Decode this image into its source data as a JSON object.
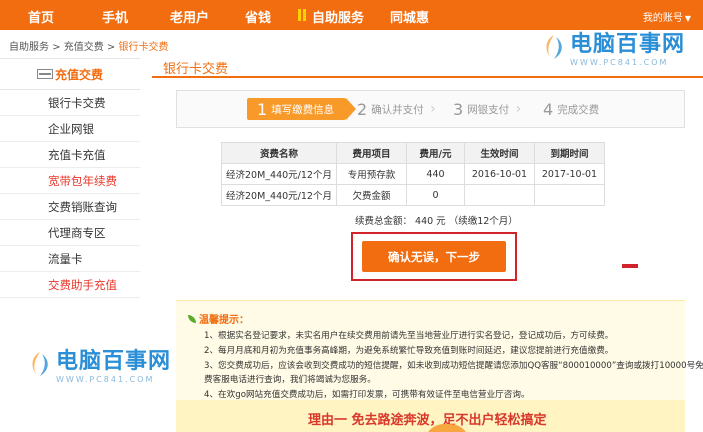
{
  "nav": {
    "items": [
      "首页",
      "手机",
      "老用户",
      "省钱",
      "自助服务",
      "同城惠"
    ],
    "account": "我的账号"
  },
  "breadcrumb": {
    "parts": [
      "自助服务",
      "充值交费"
    ],
    "current": "银行卡交费",
    "sep": " > "
  },
  "watermark": {
    "name": "电脑百事网",
    "url": "WWW.PC841.COM"
  },
  "sidebar": {
    "header": "充值交费",
    "items": [
      {
        "label": "银行卡交费",
        "hot": false
      },
      {
        "label": "企业网银",
        "hot": false
      },
      {
        "label": "充值卡充值",
        "hot": false
      },
      {
        "label": "宽带包年续费",
        "hot": true
      },
      {
        "label": "交费销账查询",
        "hot": false
      },
      {
        "label": "代理商专区",
        "hot": false
      },
      {
        "label": "流量卡",
        "hot": false
      },
      {
        "label": "交费助手充值",
        "hot": true
      }
    ]
  },
  "main": {
    "title": "银行卡交费",
    "steps": [
      {
        "num": "1",
        "label": "填写缴费信息"
      },
      {
        "num": "2",
        "label": "确认并支付"
      },
      {
        "num": "3",
        "label": "网银支付"
      },
      {
        "num": "4",
        "label": "完成交费"
      }
    ],
    "table": {
      "headers": [
        "资费名称",
        "费用项目",
        "费用/元",
        "生效时间",
        "到期时间"
      ],
      "rows": [
        [
          "经济20M_440元/12个月",
          "专用预存款",
          "440",
          "2016-10-01",
          "2017-10-01"
        ],
        [
          "经济20M_440元/12个月",
          "欠费金额",
          "0",
          "",
          ""
        ]
      ]
    },
    "total": "续费总金额： 440  元  （续缴12个月）",
    "confirm_button": "确认无误，下一步"
  },
  "tips": {
    "title": "温馨提示：",
    "lines": [
      "1、根据实名登记要求，未实名用户在续交费用前请先至当地营业厅进行实名登记，登记成功后，方可续费。",
      "2、每月月底和月初为充值事务高峰期，为避免系统繁忙导致充值到账时间延迟，建议您提前进行充值缴费。",
      "3、您交费成功后，应该会收到交费成功的短信提醒，如未收到成功短信提醒请您添加QQ客服“800010000”查询或拨打10000号免",
      "费客服电话进行查询，我们将竭诚为您服务。",
      "4、在欢go网站充值交费成功后，如需打印发票，可携带有效证件至电信营业厅咨询。"
    ]
  },
  "banner": {
    "slogan": "理由一  免去路途奔波，足不出户轻松搞定"
  },
  "colors": {
    "brand_orange": "#f26d10",
    "highlight_red": "#d2232a",
    "hot_text": "#e8372a",
    "watermark_blue": "#2a8fd6"
  }
}
